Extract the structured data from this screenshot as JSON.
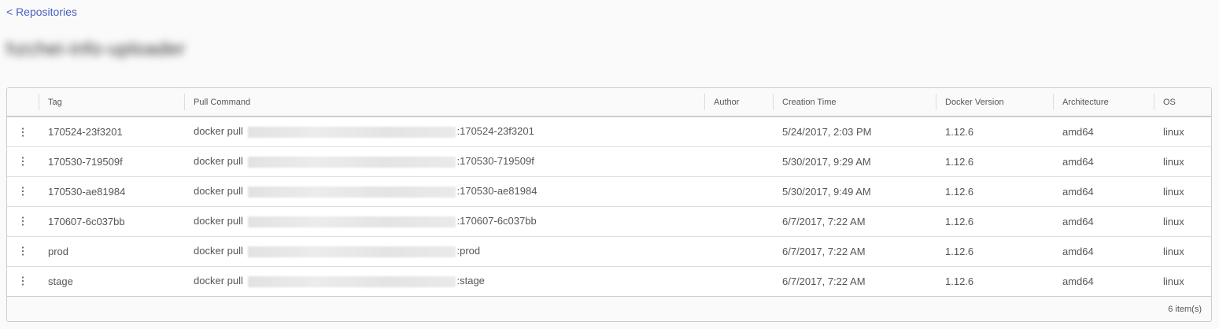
{
  "nav": {
    "back_label": "< Repositories"
  },
  "repository": {
    "name": "hzchei-info-uploader"
  },
  "table": {
    "columns": [
      "",
      "Tag",
      "Pull Command",
      "Author",
      "Creation Time",
      "Docker Version",
      "Architecture",
      "OS"
    ],
    "rows": [
      {
        "tag": "170524-23f3201",
        "pull_prefix": "docker pull",
        "pull_suffix": ":170524-23f3201",
        "author": "",
        "created": "5/24/2017, 2:03 PM",
        "docker_version": "1.12.6",
        "arch": "amd64",
        "os": "linux"
      },
      {
        "tag": "170530-719509f",
        "pull_prefix": "docker pull",
        "pull_suffix": ":170530-719509f",
        "author": "",
        "created": "5/30/2017, 9:29 AM",
        "docker_version": "1.12.6",
        "arch": "amd64",
        "os": "linux"
      },
      {
        "tag": "170530-ae81984",
        "pull_prefix": "docker pull",
        "pull_suffix": ":170530-ae81984",
        "author": "",
        "created": "5/30/2017, 9:49 AM",
        "docker_version": "1.12.6",
        "arch": "amd64",
        "os": "linux"
      },
      {
        "tag": "170607-6c037bb",
        "pull_prefix": "docker pull",
        "pull_suffix": ":170607-6c037bb",
        "author": "",
        "created": "6/7/2017, 7:22 AM",
        "docker_version": "1.12.6",
        "arch": "amd64",
        "os": "linux"
      },
      {
        "tag": "prod",
        "pull_prefix": "docker pull",
        "pull_suffix": ":prod",
        "author": "",
        "created": "6/7/2017, 7:22 AM",
        "docker_version": "1.12.6",
        "arch": "amd64",
        "os": "linux"
      },
      {
        "tag": "stage",
        "pull_prefix": "docker pull",
        "pull_suffix": ":stage",
        "author": "",
        "created": "6/7/2017, 7:22 AM",
        "docker_version": "1.12.6",
        "arch": "amd64",
        "os": "linux"
      }
    ],
    "footer_count": "6 item(s)"
  },
  "icons": {
    "row_menu": "kebab-menu-icon"
  },
  "colors": {
    "link": "#4a5fc1",
    "border": "#cccccc",
    "text": "#565656"
  }
}
